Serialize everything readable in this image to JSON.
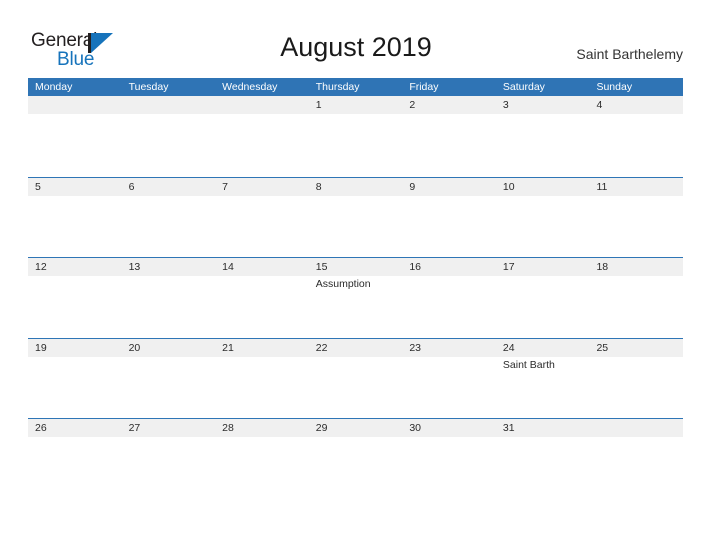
{
  "brand": {
    "name_top": "General",
    "name_bottom": "Blue",
    "logo_icon": "triangle-flag-icon",
    "color_text": "#231f20",
    "color_accent": "#1673bb"
  },
  "header": {
    "title": "August 2019",
    "region": "Saint Barthelemy"
  },
  "theme": {
    "header_blue": "#2f74b5",
    "divider_blue": "#2e75b6",
    "day_band_gray": "#f0f0f0",
    "text_dark": "#2b2b2b"
  },
  "calendar": {
    "weekdays": [
      "Monday",
      "Tuesday",
      "Wednesday",
      "Thursday",
      "Friday",
      "Saturday",
      "Sunday"
    ],
    "weeks": [
      {
        "days": [
          {
            "date": "",
            "event": ""
          },
          {
            "date": "",
            "event": ""
          },
          {
            "date": "",
            "event": ""
          },
          {
            "date": "1",
            "event": ""
          },
          {
            "date": "2",
            "event": ""
          },
          {
            "date": "3",
            "event": ""
          },
          {
            "date": "4",
            "event": ""
          }
        ]
      },
      {
        "days": [
          {
            "date": "5",
            "event": ""
          },
          {
            "date": "6",
            "event": ""
          },
          {
            "date": "7",
            "event": ""
          },
          {
            "date": "8",
            "event": ""
          },
          {
            "date": "9",
            "event": ""
          },
          {
            "date": "10",
            "event": ""
          },
          {
            "date": "11",
            "event": ""
          }
        ]
      },
      {
        "days": [
          {
            "date": "12",
            "event": ""
          },
          {
            "date": "13",
            "event": ""
          },
          {
            "date": "14",
            "event": ""
          },
          {
            "date": "15",
            "event": "Assumption"
          },
          {
            "date": "16",
            "event": ""
          },
          {
            "date": "17",
            "event": ""
          },
          {
            "date": "18",
            "event": ""
          }
        ]
      },
      {
        "days": [
          {
            "date": "19",
            "event": ""
          },
          {
            "date": "20",
            "event": ""
          },
          {
            "date": "21",
            "event": ""
          },
          {
            "date": "22",
            "event": ""
          },
          {
            "date": "23",
            "event": ""
          },
          {
            "date": "24",
            "event": "Saint Barth"
          },
          {
            "date": "25",
            "event": ""
          }
        ]
      },
      {
        "days": [
          {
            "date": "26",
            "event": ""
          },
          {
            "date": "27",
            "event": ""
          },
          {
            "date": "28",
            "event": ""
          },
          {
            "date": "29",
            "event": ""
          },
          {
            "date": "30",
            "event": ""
          },
          {
            "date": "31",
            "event": ""
          },
          {
            "date": "",
            "event": ""
          }
        ]
      }
    ]
  }
}
